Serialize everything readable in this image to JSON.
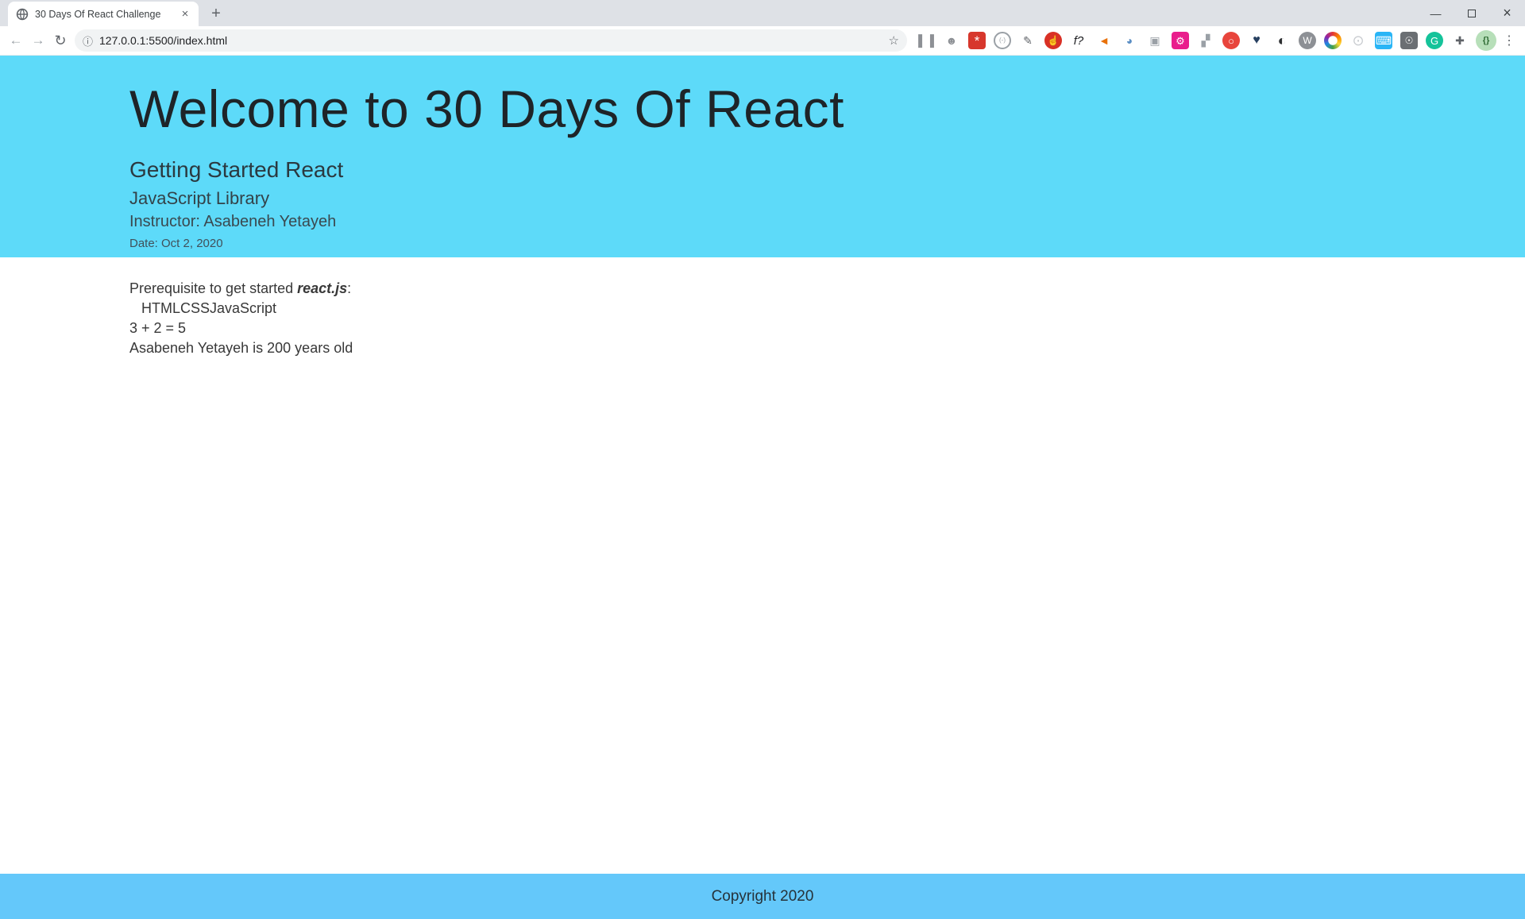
{
  "browser": {
    "tab": {
      "title": "30 Days Of React Challenge",
      "favicon": "globe-icon"
    },
    "new_tab_glyph": "+",
    "window_controls": {
      "minimize": "—",
      "close": "×"
    },
    "nav": {
      "back_glyph": "←",
      "forward_glyph": "→",
      "reload_glyph": "↻"
    },
    "omnibox": {
      "info_glyph": "ⓘ",
      "url": "127.0.0.1:5500/index.html",
      "star_glyph": "☆"
    },
    "extensions": [
      {
        "name": "side-panels-icon",
        "glyph": "▌▐",
        "fg": "#8d9095"
      },
      {
        "name": "bug-icon",
        "glyph": "☻",
        "fg": "#8d9095"
      },
      {
        "name": "web-scraper-icon",
        "glyph": "*",
        "fg": "#ffffff",
        "bg": "#d7372c",
        "shape": "square",
        "size": 17
      },
      {
        "name": "face-circle-icon",
        "glyph": "(-)",
        "fg": "#9aa0a6",
        "border": "#9aa0a6",
        "size": 8
      },
      {
        "name": "color-picker-icon",
        "glyph": "✎",
        "fg": "#5f6368"
      },
      {
        "name": "stop-hand-icon",
        "glyph": "☝",
        "fg": "#ffffff",
        "bg": "#d93025",
        "shape": "circle",
        "size": 12
      },
      {
        "name": "f-question-icon",
        "glyph": "f?",
        "fg": "#202124",
        "italic": true,
        "size": 15
      },
      {
        "name": "megaphone-icon",
        "glyph": "◄",
        "fg": "#e8710a"
      },
      {
        "name": "swirl-circle-icon",
        "glyph": "◕",
        "fg": "#5b8ec4"
      },
      {
        "name": "camera-icon",
        "glyph": "▣",
        "fg": "#9aa0a6"
      },
      {
        "name": "pink-gear-icon",
        "glyph": "⚙",
        "fg": "#ffffff",
        "bg": "#e91e8c",
        "shape": "square",
        "size": 13
      },
      {
        "name": "blocks-icon",
        "glyph": "▞",
        "fg": "#9aa0a6"
      },
      {
        "name": "red-ring-icon",
        "glyph": "○",
        "fg": "#ffffff",
        "bg": "#e8453c",
        "shape": "circle",
        "size": 13
      },
      {
        "name": "heart-search-icon",
        "glyph": "♥",
        "fg": "#274060",
        "size": 16
      },
      {
        "name": "power-circle-icon",
        "glyph": "◐",
        "fg": "#2d2f31",
        "size": 18
      },
      {
        "name": "wordpress-icon",
        "glyph": "W",
        "fg": "#ffffff",
        "bg": "#8d9095",
        "shape": "circle",
        "size": 12
      },
      {
        "name": "rainbow-ring-icon",
        "kind": "ring"
      },
      {
        "name": "orbit-icon",
        "glyph": "⊙",
        "fg": "#c9ccd0",
        "size": 18
      },
      {
        "name": "keyboard-icon",
        "glyph": "⌨",
        "fg": "#ffffff",
        "bg": "#29b5f6",
        "shape": "square",
        "size": 14
      },
      {
        "name": "lightbulb-icon",
        "glyph": "☉",
        "fg": "#ffffff",
        "bg": "#6b6f73",
        "shape": "square",
        "size": 12
      },
      {
        "name": "grammarly-icon",
        "glyph": "G",
        "fg": "#ffffff",
        "bg": "#15c39a",
        "shape": "circle",
        "size": 13
      },
      {
        "name": "puzzle-icon",
        "glyph": "✚",
        "fg": "#5f6368"
      }
    ],
    "avatar_glyph": "{}",
    "menu_glyph": "⋮"
  },
  "page": {
    "colors": {
      "header_bg": "#5ddaf9",
      "footer_bg": "#64c8fa"
    },
    "header": {
      "title": "Welcome to 30 Days Of React",
      "subtitle": "Getting Started React",
      "library": "JavaScript Library",
      "instructor": "Instructor: Asabeneh Yetayeh",
      "date": "Date: Oct 2, 2020"
    },
    "main": {
      "prerequisite_prefix": "Prerequisite to get started ",
      "prerequisite_highlight": "react.js",
      "prerequisite_suffix": ":",
      "technologies": "HTMLCSSJavaScript",
      "sum_line": "3 + 2 = 5",
      "age_line": "Asabeneh Yetayeh is 200 years old"
    },
    "footer": {
      "copyright": "Copyright 2020"
    }
  }
}
